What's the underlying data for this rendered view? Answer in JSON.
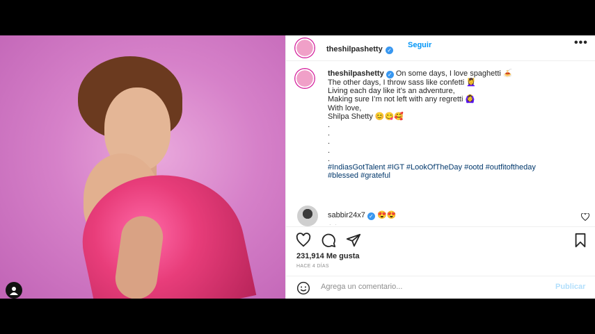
{
  "post": {
    "username": "theshilpashetty",
    "follow_label": "Seguir",
    "more_label": "•••",
    "caption_lines": [
      "On some days, I love spaghetti 🍝",
      "The other days, I throw sass like confetti 💆‍♀️",
      "Living each day like it’s an adventure,",
      "Making sure I’m not left with any regretti 🙆‍♀️",
      "With love,",
      "Shilpa Shetty 😊😋🥰",
      ".",
      ".",
      ".",
      ".",
      "."
    ],
    "hashtags_line1": "#IndiasGotTalent #IGT #LookOfTheDay #ootd #outfitoftheday",
    "hashtags_line2": "#blessed #grateful",
    "age": "4 d",
    "reply_username": "sabbir24x7",
    "reply_text": "😍😍",
    "likes": "231,914 Me gusta",
    "timestamp": "HACE 4 DÍAS",
    "comment_placeholder": "Agrega un comentario...",
    "publish_label": "Publicar"
  },
  "colors": {
    "link": "#0095f6",
    "hashtag": "#00376b",
    "verified": "#3897f0"
  }
}
